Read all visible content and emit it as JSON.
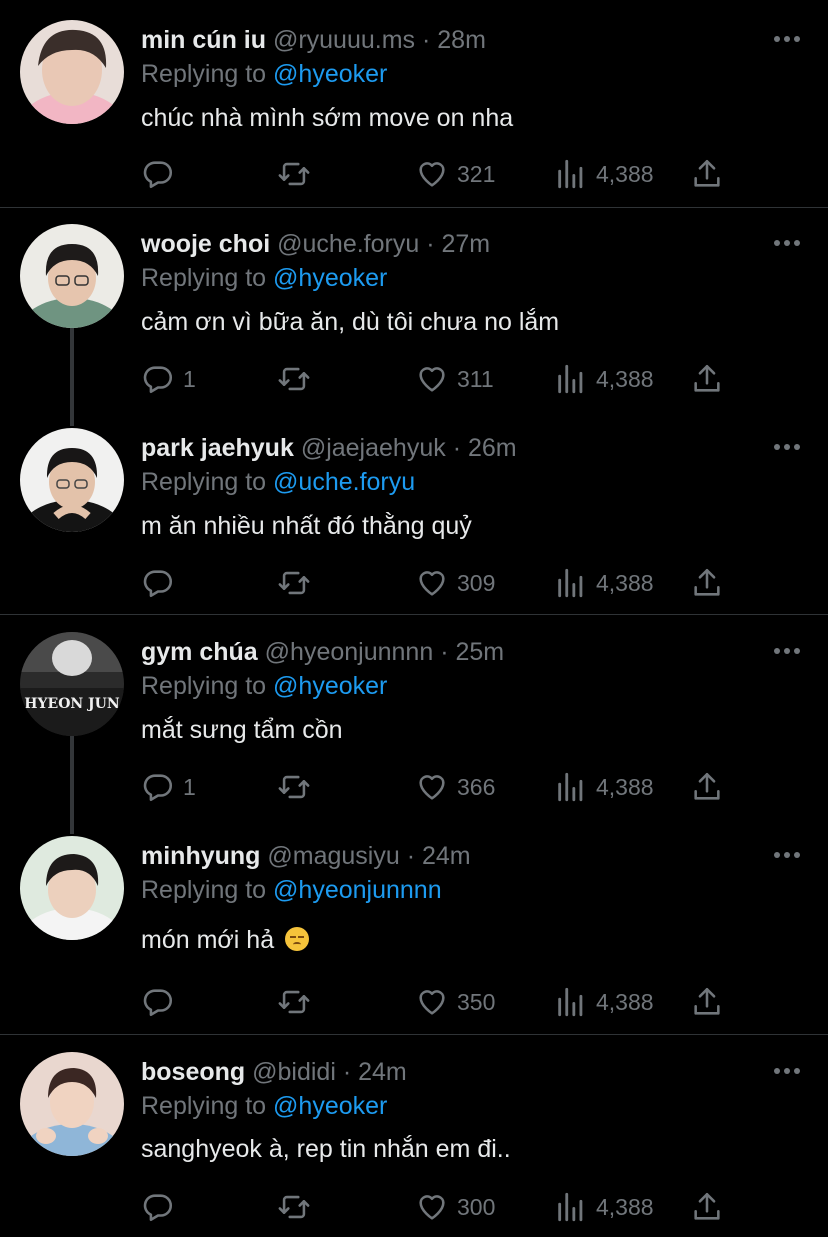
{
  "colors": {
    "background": "#000000",
    "text": "#e7e9ea",
    "muted": "#71767b",
    "mention": "#1d9bf0",
    "divider": "#2f3336"
  },
  "icons": {
    "reply": "reply-icon",
    "retweet": "retweet-icon",
    "like": "heart-icon",
    "views": "views-icon",
    "share": "share-icon",
    "more": "more-icon"
  },
  "replying_label": "Replying to",
  "dot": "·",
  "tweets": [
    {
      "name": "min cún iu",
      "handle": "@ryuuuu.ms",
      "time": "28m",
      "replying_to": "@hyeoker",
      "text": "chúc nhà mình sớm move on nha",
      "replies": "",
      "likes": "321",
      "views": "4,388"
    },
    {
      "name": "wooje choi",
      "handle": "@uche.foryu",
      "time": "27m",
      "replying_to": "@hyeoker",
      "text": "cảm ơn vì bữa ăn, dù tôi chưa no lắm",
      "replies": "1",
      "likes": "311",
      "views": "4,388"
    },
    {
      "name": "park jaehyuk",
      "handle": "@jaejaehyuk",
      "time": "26m",
      "replying_to": "@uche.foryu",
      "text": "m ăn nhiều nhất đó thằng quỷ",
      "replies": "",
      "likes": "309",
      "views": "4,388"
    },
    {
      "name": "gym chúa",
      "handle": "@hyeonjunnnn",
      "time": "25m",
      "replying_to": "@hyeoker",
      "text": "mắt sưng tẩm cồn",
      "replies": "1",
      "likes": "366",
      "views": "4,388",
      "avatar_text": "HYEON JUN"
    },
    {
      "name": "minhyung",
      "handle": "@magusiyu",
      "time": "24m",
      "replying_to": "@hyeonjunnnn",
      "text": "món mới hả",
      "emoji": "disappointed-face",
      "replies": "",
      "likes": "350",
      "views": "4,388"
    },
    {
      "name": "boseong",
      "handle": "@bididi",
      "time": "24m",
      "replying_to": "@hyeoker",
      "text": "sanghyeok à, rep tin nhắn em đi..",
      "replies": "",
      "likes": "300",
      "views": "4,388"
    }
  ]
}
